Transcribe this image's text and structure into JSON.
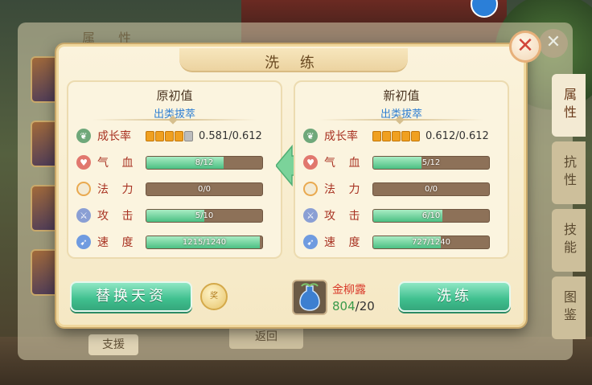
{
  "background": {
    "under_title": "属 性",
    "side_tabs": [
      "属性",
      "抗性",
      "技能",
      "图鉴"
    ],
    "support_label": "支援",
    "return_label": "返回",
    "under_close": "✕"
  },
  "dialog": {
    "title": "洗 练",
    "close": "✕",
    "left": {
      "heading": "原初值",
      "grade": "出类拔萃",
      "growth": {
        "label": "成长率",
        "value": "0.581/0.612",
        "pips_filled": 4,
        "pips_total": 5
      },
      "stats": [
        {
          "label": "气 血",
          "text": "8/12",
          "fraction": 0.667,
          "icon": "heart-icon"
        },
        {
          "label": "法 力",
          "text": "0/0",
          "fraction": 0,
          "icon": "mana-icon"
        },
        {
          "label": "攻 击",
          "text": "5/10",
          "fraction": 0.5,
          "icon": "sword-icon"
        },
        {
          "label": "速 度",
          "text": "1215/1240",
          "fraction": 0.98,
          "icon": "speed-icon"
        }
      ]
    },
    "right": {
      "heading": "新初值",
      "grade": "出类拔萃",
      "growth": {
        "label": "成长率",
        "value": "0.612/0.612",
        "pips_filled": 5,
        "pips_total": 5
      },
      "stats": [
        {
          "label": "气 血",
          "text": "5/12",
          "fraction": 0.417,
          "icon": "heart-icon"
        },
        {
          "label": "法 力",
          "text": "0/0",
          "fraction": 0,
          "icon": "mana-icon"
        },
        {
          "label": "攻 击",
          "text": "6/10",
          "fraction": 0.6,
          "icon": "sword-icon"
        },
        {
          "label": "速 度",
          "text": "727/1240",
          "fraction": 0.586,
          "icon": "speed-icon"
        }
      ]
    },
    "replace_button": "替换天资",
    "coin_label": "奖",
    "refine_button": "洗练",
    "item": {
      "name": "金柳露",
      "have": "804",
      "need": "/20"
    }
  },
  "colors": {
    "accent_green": "#3fbf8e",
    "label_red": "#a83222",
    "grade_blue": "#2f7fd2"
  }
}
